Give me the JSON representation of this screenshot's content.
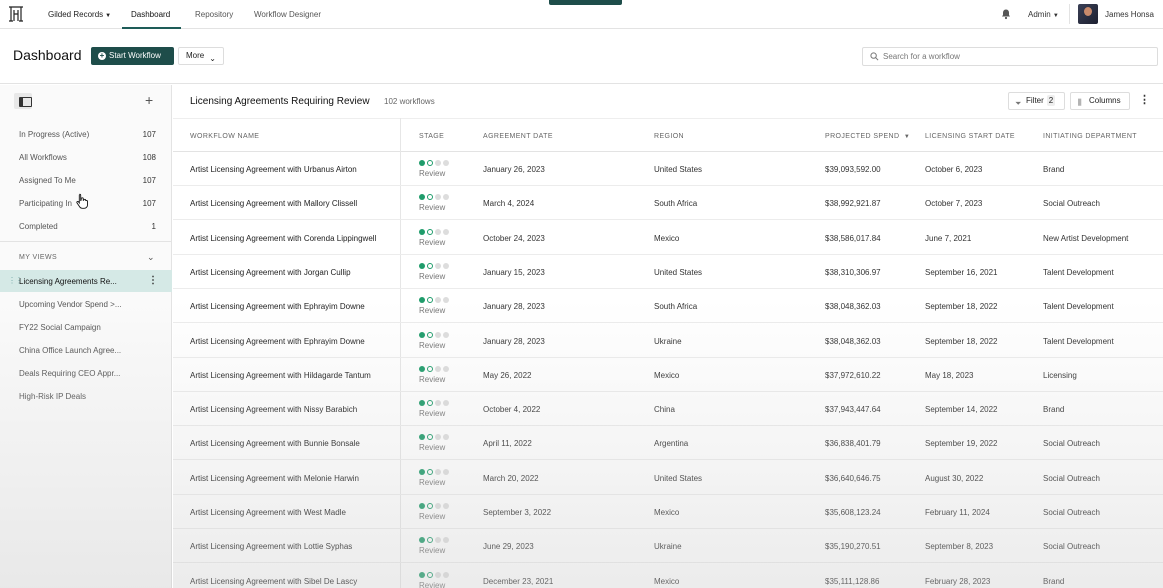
{
  "topbar": {
    "org": "Gilded Records",
    "nav": [
      "Dashboard",
      "Repository",
      "Workflow Designer"
    ],
    "admin": "Admin",
    "user": "James Honsa"
  },
  "header": {
    "title": "Dashboard",
    "start_label": "Start Workflow",
    "more_label": "More",
    "search_placeholder": "Search for a workflow"
  },
  "sidebar": {
    "items": [
      {
        "label": "In Progress (Active)",
        "count": "107"
      },
      {
        "label": "All Workflows",
        "count": "108"
      },
      {
        "label": "Assigned To Me",
        "count": "107"
      },
      {
        "label": "Participating In",
        "count": "107"
      },
      {
        "label": "Completed",
        "count": "1"
      }
    ],
    "my_views_label": "MY VIEWS",
    "views": [
      "Licensing Agreements Re...",
      "Upcoming Vendor Spend >...",
      "FY22 Social Campaign",
      "China Office Launch Agree...",
      "Deals Requiring CEO Appr...",
      "High-Risk IP Deals"
    ]
  },
  "list": {
    "title": "Licensing Agreements Requiring Review",
    "count": "102 workflows",
    "filter_label": "Filter",
    "filter_count": "2",
    "columns_label": "Columns",
    "headers": {
      "name": "WORKFLOW NAME",
      "stage": "STAGE",
      "date": "AGREEMENT DATE",
      "region": "REGION",
      "spend": "PROJECTED SPEND",
      "start": "LICENSING START DATE",
      "dept": "INITIATING DEPARTMENT"
    },
    "stage_label": "Review",
    "rows": [
      {
        "name": "Artist Licensing Agreement with Urbanus Airton",
        "date": "January 26, 2023",
        "region": "United States",
        "spend": "$39,093,592.00",
        "start": "October 6, 2023",
        "dept": "Brand"
      },
      {
        "name": "Artist Licensing Agreement with Mallory Clissell",
        "date": "March 4, 2024",
        "region": "South Africa",
        "spend": "$38,992,921.87",
        "start": "October 7, 2023",
        "dept": "Social Outreach"
      },
      {
        "name": "Artist Licensing Agreement with Corenda Lippingwell",
        "date": "October 24, 2023",
        "region": "Mexico",
        "spend": "$38,586,017.84",
        "start": "June 7, 2021",
        "dept": "New Artist Development"
      },
      {
        "name": "Artist Licensing Agreement with Jorgan Cullip",
        "date": "January 15, 2023",
        "region": "United States",
        "spend": "$38,310,306.97",
        "start": "September 16, 2021",
        "dept": "Talent Development"
      },
      {
        "name": "Artist Licensing Agreement with Ephrayim Downe",
        "date": "January 28, 2023",
        "region": "South Africa",
        "spend": "$38,048,362.03",
        "start": "September 18, 2022",
        "dept": "Talent Development"
      },
      {
        "name": "Artist Licensing Agreement with Ephrayim Downe",
        "date": "January 28, 2023",
        "region": "Ukraine",
        "spend": "$38,048,362.03",
        "start": "September 18, 2022",
        "dept": "Talent Development"
      },
      {
        "name": "Artist Licensing Agreement with Hildagarde Tantum",
        "date": "May 26, 2022",
        "region": "Mexico",
        "spend": "$37,972,610.22",
        "start": "May 18, 2023",
        "dept": "Licensing"
      },
      {
        "name": "Artist Licensing Agreement with Nissy Barabich",
        "date": "October 4, 2022",
        "region": "China",
        "spend": "$37,943,447.64",
        "start": "September 14, 2022",
        "dept": "Brand"
      },
      {
        "name": "Artist Licensing Agreement with Bunnie Bonsale",
        "date": "April 11, 2022",
        "region": "Argentina",
        "spend": "$36,838,401.79",
        "start": "September 19, 2022",
        "dept": "Social Outreach"
      },
      {
        "name": "Artist Licensing Agreement with Melonie Harwin",
        "date": "March 20, 2022",
        "region": "United States",
        "spend": "$36,640,646.75",
        "start": "August 30, 2022",
        "dept": "Social Outreach"
      },
      {
        "name": "Artist Licensing Agreement with West Madle",
        "date": "September 3, 2022",
        "region": "Mexico",
        "spend": "$35,608,123.24",
        "start": "February 11, 2024",
        "dept": "Social Outreach"
      },
      {
        "name": "Artist Licensing Agreement with Lottie Syphas",
        "date": "June 29, 2023",
        "region": "Ukraine",
        "spend": "$35,190,270.51",
        "start": "September 8, 2023",
        "dept": "Social Outreach"
      },
      {
        "name": "Artist Licensing Agreement with Sibel De Lascy",
        "date": "December 23, 2021",
        "region": "Mexico",
        "spend": "$35,111,128.86",
        "start": "February 28, 2023",
        "dept": "Brand"
      }
    ]
  }
}
